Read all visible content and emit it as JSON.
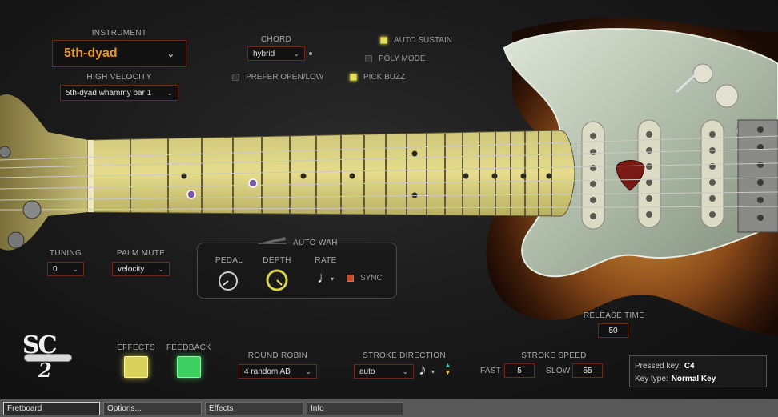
{
  "instrument": {
    "label": "INSTRUMENT",
    "value": "5th-dyad"
  },
  "high_velocity": {
    "label": "HIGH VELOCITY",
    "value": "5th-dyad whammy bar 1"
  },
  "chord": {
    "label": "CHORD",
    "value": "hybrid"
  },
  "toggles": {
    "auto_sustain": {
      "label": "AUTO SUSTAIN",
      "on": true
    },
    "poly_mode": {
      "label": "POLY MODE",
      "on": false
    },
    "prefer_open_low": {
      "label": "PREFER OPEN/LOW",
      "on": false
    },
    "pick_buzz": {
      "label": "PICK BUZZ",
      "on": true
    }
  },
  "tuning": {
    "label": "TUNING",
    "value": "0"
  },
  "palm_mute": {
    "label": "PALM MUTE",
    "value": "velocity"
  },
  "auto_wah": {
    "title": "AUTO WAH",
    "pedal_label": "PEDAL",
    "depth_label": "DEPTH",
    "rate_label": "RATE",
    "sync_label": "SYNC"
  },
  "release_time": {
    "label": "RELEASE TIME",
    "value": "50"
  },
  "effects": {
    "label": "EFFECTS"
  },
  "feedback": {
    "label": "FEEDBACK"
  },
  "round_robin": {
    "label": "ROUND ROBIN",
    "value": "4 random AB"
  },
  "stroke_direction": {
    "label": "STROKE DIRECTION",
    "value": "auto"
  },
  "stroke_speed": {
    "label": "STROKE SPEED",
    "fast_label": "FAST",
    "fast_value": "5",
    "slow_label": "SLOW",
    "slow_value": "55"
  },
  "key_info": {
    "pressed_label": "Pressed key:",
    "pressed_value": "C4",
    "type_label": "Key type:",
    "type_value": "Normal Key"
  },
  "logo": {
    "text": "SC",
    "sub": "2"
  },
  "tabs": [
    "Fretboard",
    "Options...",
    "Effects",
    "Info"
  ],
  "colors": {
    "accent_orange": "#e8932a",
    "led_yellow": "#e8e05a",
    "led_green": "#3cd060",
    "border_red": "#6a2a1a"
  }
}
